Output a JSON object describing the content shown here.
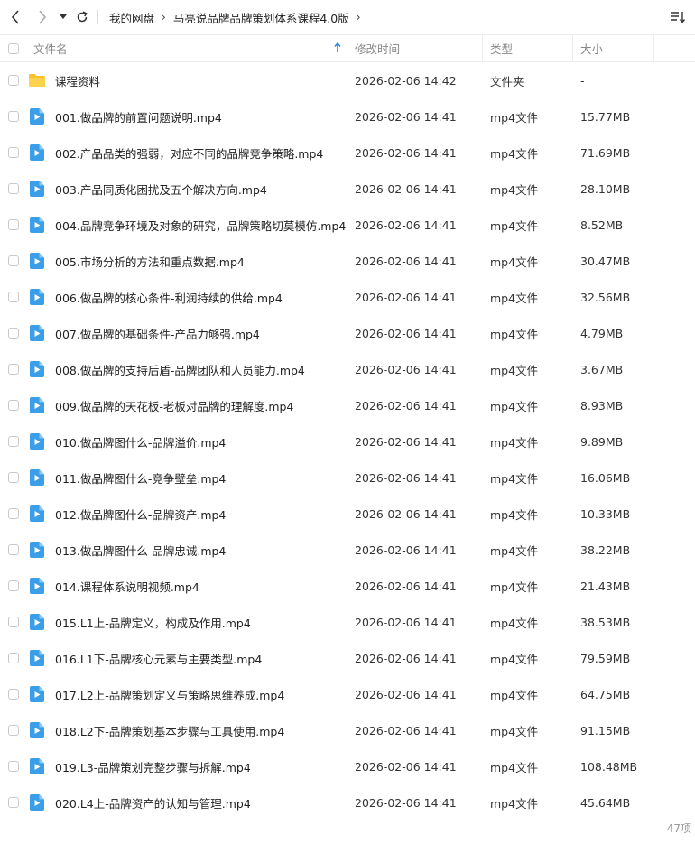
{
  "breadcrumb": {
    "items": [
      "我的网盘",
      "马亮说品牌品牌策划体系课程4.0版"
    ]
  },
  "columns": {
    "name": "文件名",
    "modified": "修改时间",
    "type": "类型",
    "size": "大小"
  },
  "files": [
    {
      "name": "课程资料",
      "modified": "2026-02-06 14:42",
      "type": "文件夹",
      "size": "-",
      "icon": "folder-icon"
    },
    {
      "name": "001.做品牌的前置问题说明.mp4",
      "modified": "2026-02-06 14:41",
      "type": "mp4文件",
      "size": "15.77MB",
      "icon": "video-file-icon"
    },
    {
      "name": "002.产品品类的强弱，对应不同的品牌竞争策略.mp4",
      "modified": "2026-02-06 14:41",
      "type": "mp4文件",
      "size": "71.69MB",
      "icon": "video-file-icon"
    },
    {
      "name": "003.产品同质化困扰及五个解决方向.mp4",
      "modified": "2026-02-06 14:41",
      "type": "mp4文件",
      "size": "28.10MB",
      "icon": "video-file-icon"
    },
    {
      "name": "004.品牌竞争环境及对象的研究，品牌策略切莫模仿.mp4",
      "modified": "2026-02-06 14:41",
      "type": "mp4文件",
      "size": "8.52MB",
      "icon": "video-file-icon"
    },
    {
      "name": "005.市场分析的方法和重点数据.mp4",
      "modified": "2026-02-06 14:41",
      "type": "mp4文件",
      "size": "30.47MB",
      "icon": "video-file-icon"
    },
    {
      "name": "006.做品牌的核心条件-利润持续的供给.mp4",
      "modified": "2026-02-06 14:41",
      "type": "mp4文件",
      "size": "32.56MB",
      "icon": "video-file-icon"
    },
    {
      "name": "007.做品牌的基础条件-产品力够强.mp4",
      "modified": "2026-02-06 14:41",
      "type": "mp4文件",
      "size": "4.79MB",
      "icon": "video-file-icon"
    },
    {
      "name": "008.做品牌的支持后盾-品牌团队和人员能力.mp4",
      "modified": "2026-02-06 14:41",
      "type": "mp4文件",
      "size": "3.67MB",
      "icon": "video-file-icon"
    },
    {
      "name": "009.做品牌的天花板-老板对品牌的理解度.mp4",
      "modified": "2026-02-06 14:41",
      "type": "mp4文件",
      "size": "8.93MB",
      "icon": "video-file-icon"
    },
    {
      "name": "010.做品牌图什么-品牌溢价.mp4",
      "modified": "2026-02-06 14:41",
      "type": "mp4文件",
      "size": "9.89MB",
      "icon": "video-file-icon"
    },
    {
      "name": "011.做品牌图什么-竞争壁垒.mp4",
      "modified": "2026-02-06 14:41",
      "type": "mp4文件",
      "size": "16.06MB",
      "icon": "video-file-icon"
    },
    {
      "name": "012.做品牌图什么-品牌资产.mp4",
      "modified": "2026-02-06 14:41",
      "type": "mp4文件",
      "size": "10.33MB",
      "icon": "video-file-icon"
    },
    {
      "name": "013.做品牌图什么-品牌忠诚.mp4",
      "modified": "2026-02-06 14:41",
      "type": "mp4文件",
      "size": "38.22MB",
      "icon": "video-file-icon"
    },
    {
      "name": "014.课程体系说明视频.mp4",
      "modified": "2026-02-06 14:41",
      "type": "mp4文件",
      "size": "21.43MB",
      "icon": "video-file-icon"
    },
    {
      "name": "015.L1上-品牌定义，构成及作用.mp4",
      "modified": "2026-02-06 14:41",
      "type": "mp4文件",
      "size": "38.53MB",
      "icon": "video-file-icon"
    },
    {
      "name": "016.L1下-品牌核心元素与主要类型.mp4",
      "modified": "2026-02-06 14:41",
      "type": "mp4文件",
      "size": "79.59MB",
      "icon": "video-file-icon"
    },
    {
      "name": "017.L2上-品牌策划定义与策略思维养成.mp4",
      "modified": "2026-02-06 14:41",
      "type": "mp4文件",
      "size": "64.75MB",
      "icon": "video-file-icon"
    },
    {
      "name": "018.L2下-品牌策划基本步骤与工具使用.mp4",
      "modified": "2026-02-06 14:41",
      "type": "mp4文件",
      "size": "91.15MB",
      "icon": "video-file-icon"
    },
    {
      "name": "019.L3-品牌策划完整步骤与拆解.mp4",
      "modified": "2026-02-06 14:41",
      "type": "mp4文件",
      "size": "108.48MB",
      "icon": "video-file-icon"
    },
    {
      "name": "020.L4上-品牌资产的认知与管理.mp4",
      "modified": "2026-02-06 14:41",
      "type": "mp4文件",
      "size": "45.64MB",
      "icon": "video-file-icon"
    }
  ],
  "footer": {
    "count": "47项"
  },
  "colors": {
    "folder": "#fbc02d",
    "video": "#3a9ee8",
    "sort_arrow": "#2b8be6"
  }
}
